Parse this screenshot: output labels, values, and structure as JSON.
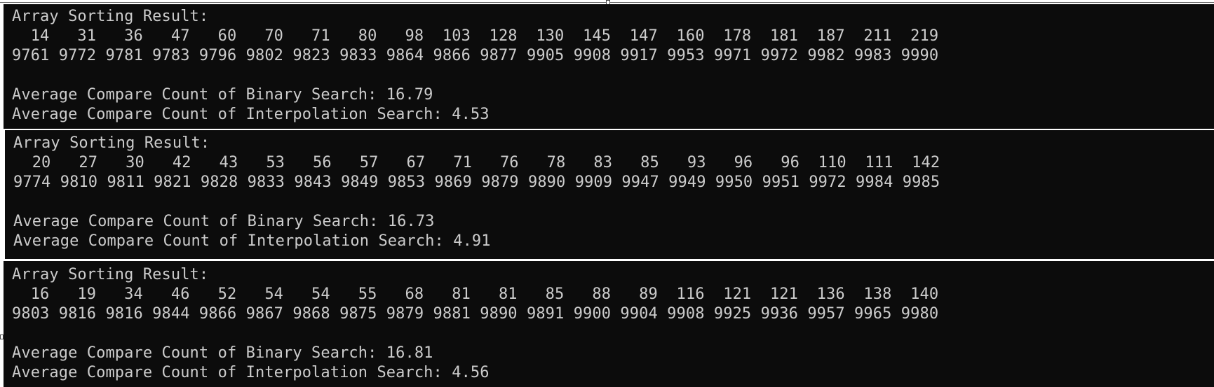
{
  "consoles": [
    {
      "lines": [
        "Array Sorting Result:",
        "  14   31   36   47   60   70   71   80   98  103  128  130  145  147  160  178  181  187  211  219",
        "9761 9772 9781 9783 9796 9802 9823 9833 9864 9866 9877 9905 9908 9917 9953 9971 9972 9982 9983 9990",
        "",
        "Average Compare Count of Binary Search: 16.79",
        "Average Compare Count of Interpolation Search: 4.53"
      ]
    },
    {
      "lines": [
        "Array Sorting Result:",
        "  20   27   30   42   43   53   56   57   67   71   76   78   83   85   93   96   96  110  111  142",
        "9774 9810 9811 9821 9828 9833 9843 9849 9853 9869 9879 9890 9909 9947 9949 9950 9951 9972 9984 9985",
        "",
        "Average Compare Count of Binary Search: 16.73",
        "Average Compare Count of Interpolation Search: 4.91"
      ]
    },
    {
      "lines": [
        "Array Sorting Result:",
        "  16   19   34   46   52   54   54   55   68   81   81   85   88   89  116  121  121  136  138  140",
        "9803 9816 9816 9844 9866 9867 9868 9875 9879 9881 9890 9891 9900 9904 9908 9925 9936 9957 9965 9980",
        "",
        "Average Compare Count of Binary Search: 16.81",
        "Average Compare Count of Interpolation Search: 4.56"
      ]
    }
  ]
}
